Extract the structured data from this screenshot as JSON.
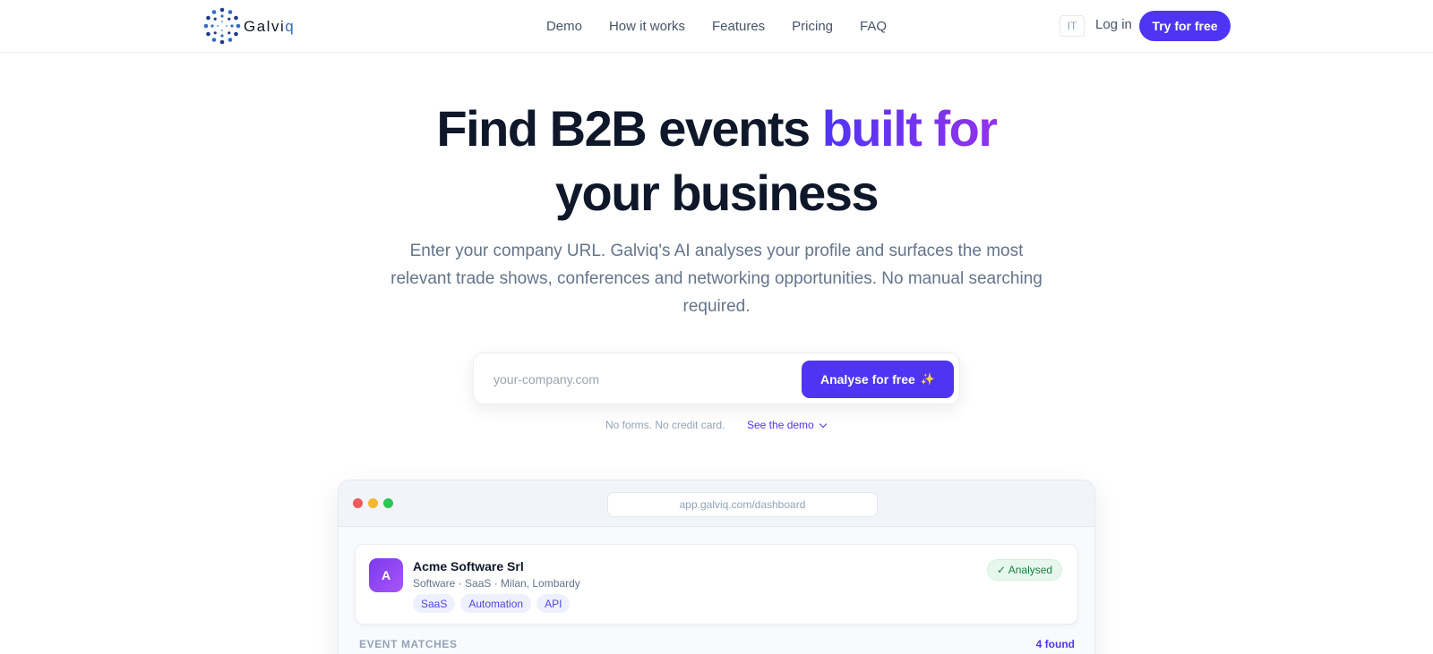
{
  "brand": {
    "name_prefix": "Galvi",
    "name_suffix": "q",
    "logo_icon": "dotted-ring-logo",
    "accent": "#4f35f3",
    "gradient_end": "#9333ea"
  },
  "nav": {
    "links": [
      "Demo",
      "How it works",
      "Features",
      "Pricing",
      "FAQ"
    ],
    "language": "IT",
    "login": "Log in",
    "cta": "Try for free"
  },
  "hero": {
    "headline_part1": "Find B2B events ",
    "headline_highlight": "built for",
    "headline_line2": "your business",
    "subtitle": "Enter your company URL. Galviq's AI analyses your profile and surfaces the most relevant trade shows, conferences and networking opportunities. No manual searching required.",
    "search": {
      "placeholder": "your-company.com",
      "value": "",
      "button": "Analyse for free",
      "button_icon": "sparkle-icon"
    },
    "note": "No forms. No credit card.",
    "demo_link": "See the demo"
  },
  "dashboard": {
    "url": "app.galviq.com/dashboard",
    "window_dots": [
      "#f05a5a",
      "#f6b731",
      "#2bc653"
    ],
    "company": {
      "initial": "A",
      "name": "Acme Software Srl",
      "meta": "Software · SaaS · Milan, Lombardy",
      "tags": [
        "SaaS",
        "Automation",
        "API"
      ],
      "status": "✓ Analysed"
    },
    "matches_title": "EVENT MATCHES",
    "matches_count": "4 found"
  }
}
